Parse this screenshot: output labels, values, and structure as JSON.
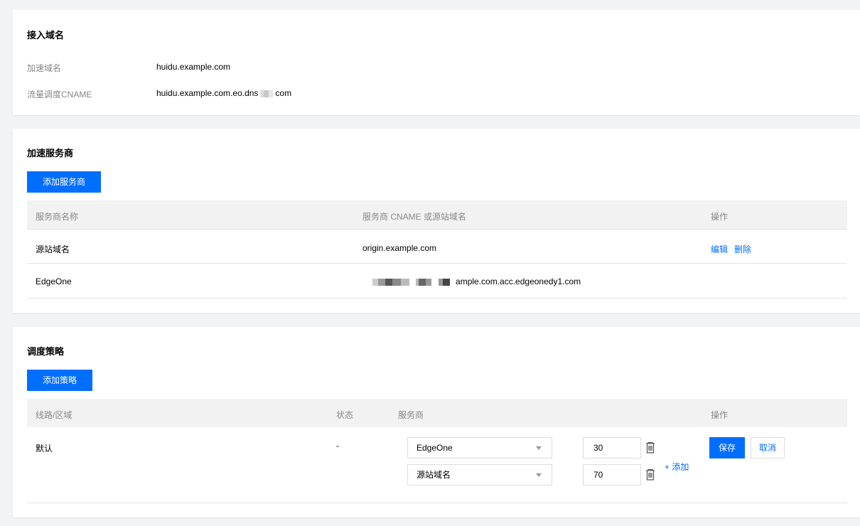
{
  "access": {
    "title": "接入域名",
    "rows": [
      {
        "label": "加速域名",
        "value": "huidu.example.com"
      },
      {
        "label": "流量调度CNAME",
        "value_prefix": "huidu.example.com.eo.dns",
        "value_suffix": "com"
      }
    ]
  },
  "providers": {
    "title": "加速服务商",
    "add_label": "添加服务商",
    "columns": [
      "服务商名称",
      "服务商 CNAME 或源站域名",
      "操作"
    ],
    "rows": [
      {
        "name": "源站域名",
        "cname": "origin.example.com",
        "edit": "编辑",
        "delete": "删除"
      },
      {
        "name": "EdgeOne",
        "cname": "ample.com.acc.edgeonedy1.com"
      }
    ]
  },
  "strategy": {
    "title": "调度策略",
    "add_label": "添加策略",
    "columns": [
      "线路/区域",
      "状态",
      "服务商",
      "操作"
    ],
    "row": {
      "region": "默认",
      "status": "-",
      "providers": [
        {
          "provider": "EdgeOne",
          "weight": "30"
        },
        {
          "provider": "源站域名",
          "weight": "70"
        }
      ],
      "add_link": "+ 添加",
      "save": "保存",
      "cancel": "取消"
    }
  },
  "colors": {
    "primary": "#006eff",
    "background": "#f2f3f5"
  }
}
